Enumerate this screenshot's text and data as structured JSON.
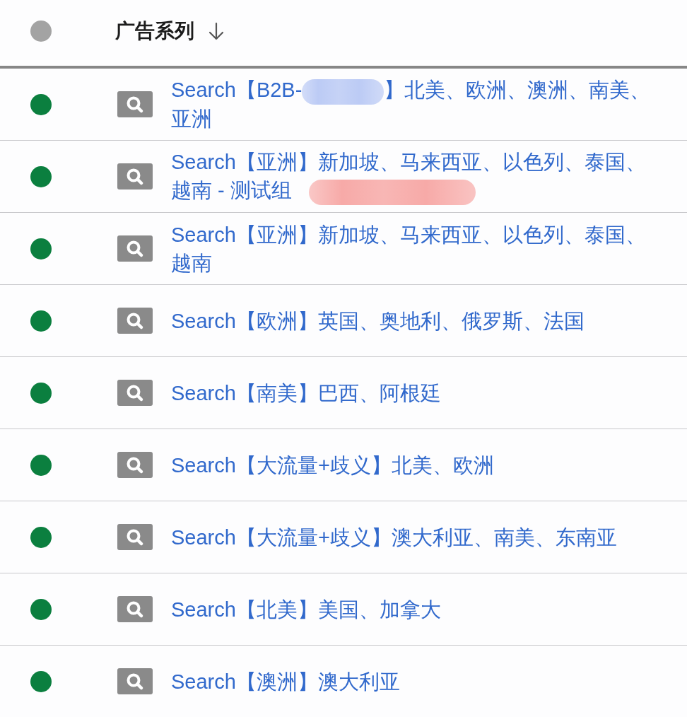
{
  "table": {
    "header": {
      "title": "广告系列",
      "sorted_descending": true
    },
    "rows": [
      {
        "color": "#0b7f3f",
        "kind": "search",
        "campaign_name": [
          {
            "kind": "text",
            "text": "Search【B2B-"
          },
          {
            "kind": "redaction",
            "color": "#bccbf5"
          },
          {
            "kind": "text",
            "text": "】北美、欧洲、澳洲、南美、亚洲"
          }
        ]
      },
      {
        "color": "#0b7f3f",
        "kind": "search",
        "campaign_name": [
          {
            "kind": "text",
            "text": "Search【亚洲】新加坡、马来西亚、以色列、泰国、越南 - 测试组"
          },
          {
            "kind": "redaction",
            "color": "#f7aaa8"
          }
        ]
      },
      {
        "color": "#0b7f3f",
        "kind": "search",
        "campaign_name": [
          {
            "kind": "text",
            "text": "Search【亚洲】新加坡、马来西亚、以色列、泰国、越南"
          }
        ]
      },
      {
        "color": "#0b7f3f",
        "kind": "search",
        "campaign_name": [
          {
            "kind": "text",
            "text": "Search【欧洲】英国、奥地利、俄罗斯、法国"
          }
        ]
      },
      {
        "color": "#0b7f3f",
        "kind": "search",
        "campaign_name": [
          {
            "kind": "text",
            "text": "Search【南美】巴西、阿根廷"
          }
        ]
      },
      {
        "color": "#0b7f3f",
        "kind": "search",
        "campaign_name": [
          {
            "kind": "text",
            "text": "Search【大流量+歧义】北美、欧洲"
          }
        ]
      },
      {
        "color": "#0b7f3f",
        "kind": "search",
        "campaign_name": [
          {
            "kind": "text",
            "text": "Search【大流量+歧义】澳大利亚、南美、东南亚"
          }
        ]
      },
      {
        "color": "#0b7f3f",
        "kind": "search",
        "campaign_name": [
          {
            "kind": "text",
            "text": "Search【北美】美国、加拿大"
          }
        ]
      },
      {
        "color": "#0b7f3f",
        "kind": "search",
        "campaign_name": [
          {
            "kind": "text",
            "text": "Search【澳洲】澳大利亚"
          }
        ]
      }
    ]
  }
}
